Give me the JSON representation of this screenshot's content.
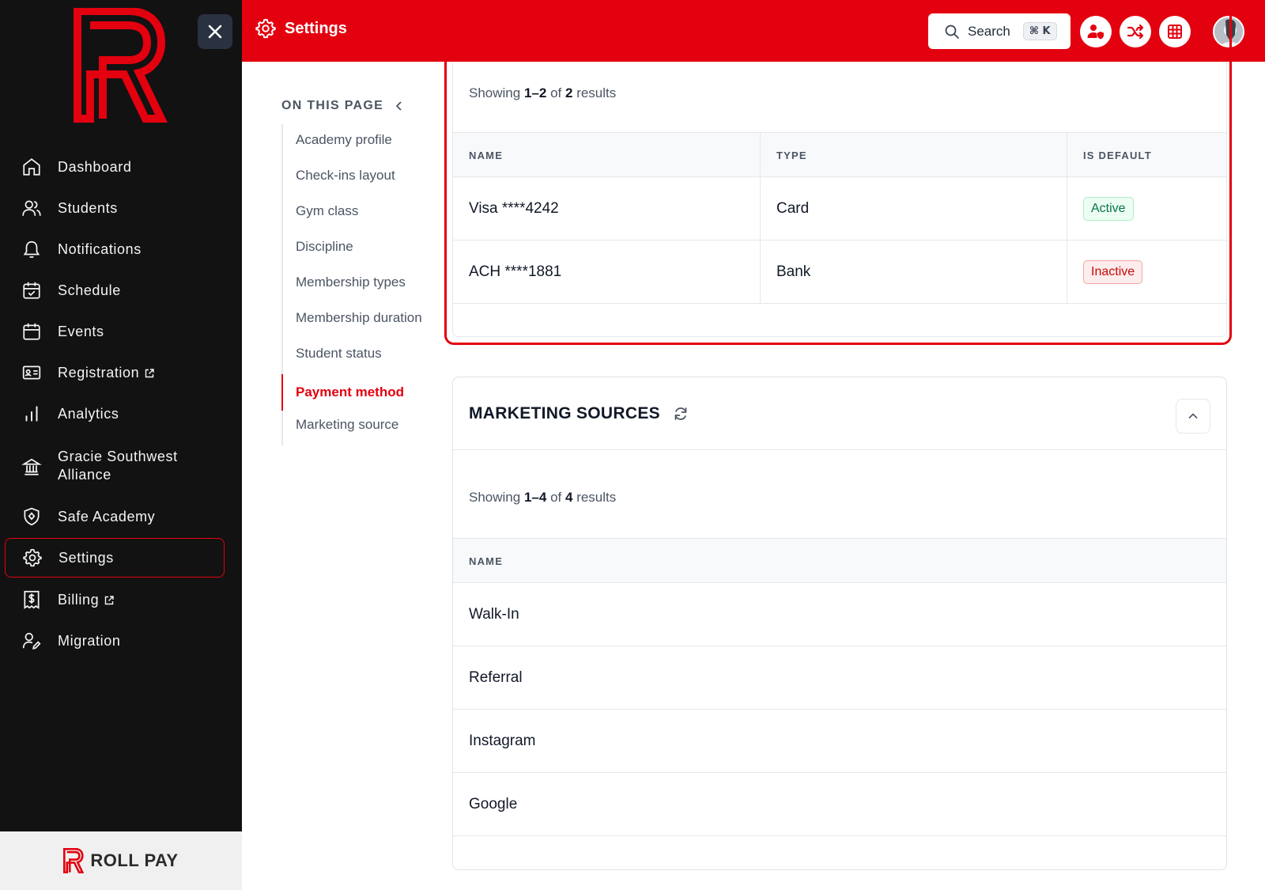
{
  "sidebar": {
    "items": [
      {
        "label": "Dashboard",
        "icon": "home-icon"
      },
      {
        "label": "Students",
        "icon": "users-icon"
      },
      {
        "label": "Notifications",
        "icon": "bell-icon"
      },
      {
        "label": "Schedule",
        "icon": "calendar-check-icon"
      },
      {
        "label": "Events",
        "icon": "calendar-icon"
      },
      {
        "label": "Registration",
        "icon": "id-card-icon",
        "external": true
      },
      {
        "label": "Analytics",
        "icon": "bar-chart-icon"
      },
      {
        "label": "Gracie Southwest",
        "label2": "Alliance",
        "icon": "bank-icon"
      },
      {
        "label": "Safe Academy",
        "icon": "shield-icon"
      },
      {
        "label": "Settings",
        "icon": "gear-icon",
        "active": true
      },
      {
        "label": "Billing",
        "icon": "receipt-dollar-icon",
        "external": true
      },
      {
        "label": "Migration",
        "icon": "user-edit-icon"
      }
    ],
    "footer_brand": "ROLL PAY"
  },
  "header": {
    "title": "Settings",
    "search_label": "Search",
    "search_shortcut": "⌘ K"
  },
  "on_this_page": {
    "title": "ON THIS PAGE",
    "items": [
      "Academy profile",
      "Check-ins layout",
      "Gym class",
      "Discipline",
      "Membership types",
      "Membership duration",
      "Student status",
      "Payment method",
      "Marketing source"
    ],
    "active_index": 7
  },
  "payment_methods": {
    "showing_prefix": "Showing",
    "showing_range": "1–2",
    "showing_of": "of",
    "showing_total": "2",
    "showing_suffix": "results",
    "columns": [
      "NAME",
      "TYPE",
      "IS DEFAULT"
    ],
    "rows": [
      {
        "name": "Visa ****4242",
        "type": "Card",
        "status": "Active"
      },
      {
        "name": "ACH ****1881",
        "type": "Bank",
        "status": "Inactive"
      }
    ]
  },
  "marketing_sources": {
    "title": "MARKETING SOURCES",
    "showing_prefix": "Showing",
    "showing_range": "1–4",
    "showing_of": "of",
    "showing_total": "4",
    "showing_suffix": "results",
    "columns": [
      "NAME"
    ],
    "rows": [
      "Walk-In",
      "Referral",
      "Instagram",
      "Google"
    ]
  },
  "colors": {
    "brand_red": "#e3000f",
    "sidebar_bg": "#121212",
    "active_green": "#067647",
    "inactive_red": "#c40a0a"
  }
}
